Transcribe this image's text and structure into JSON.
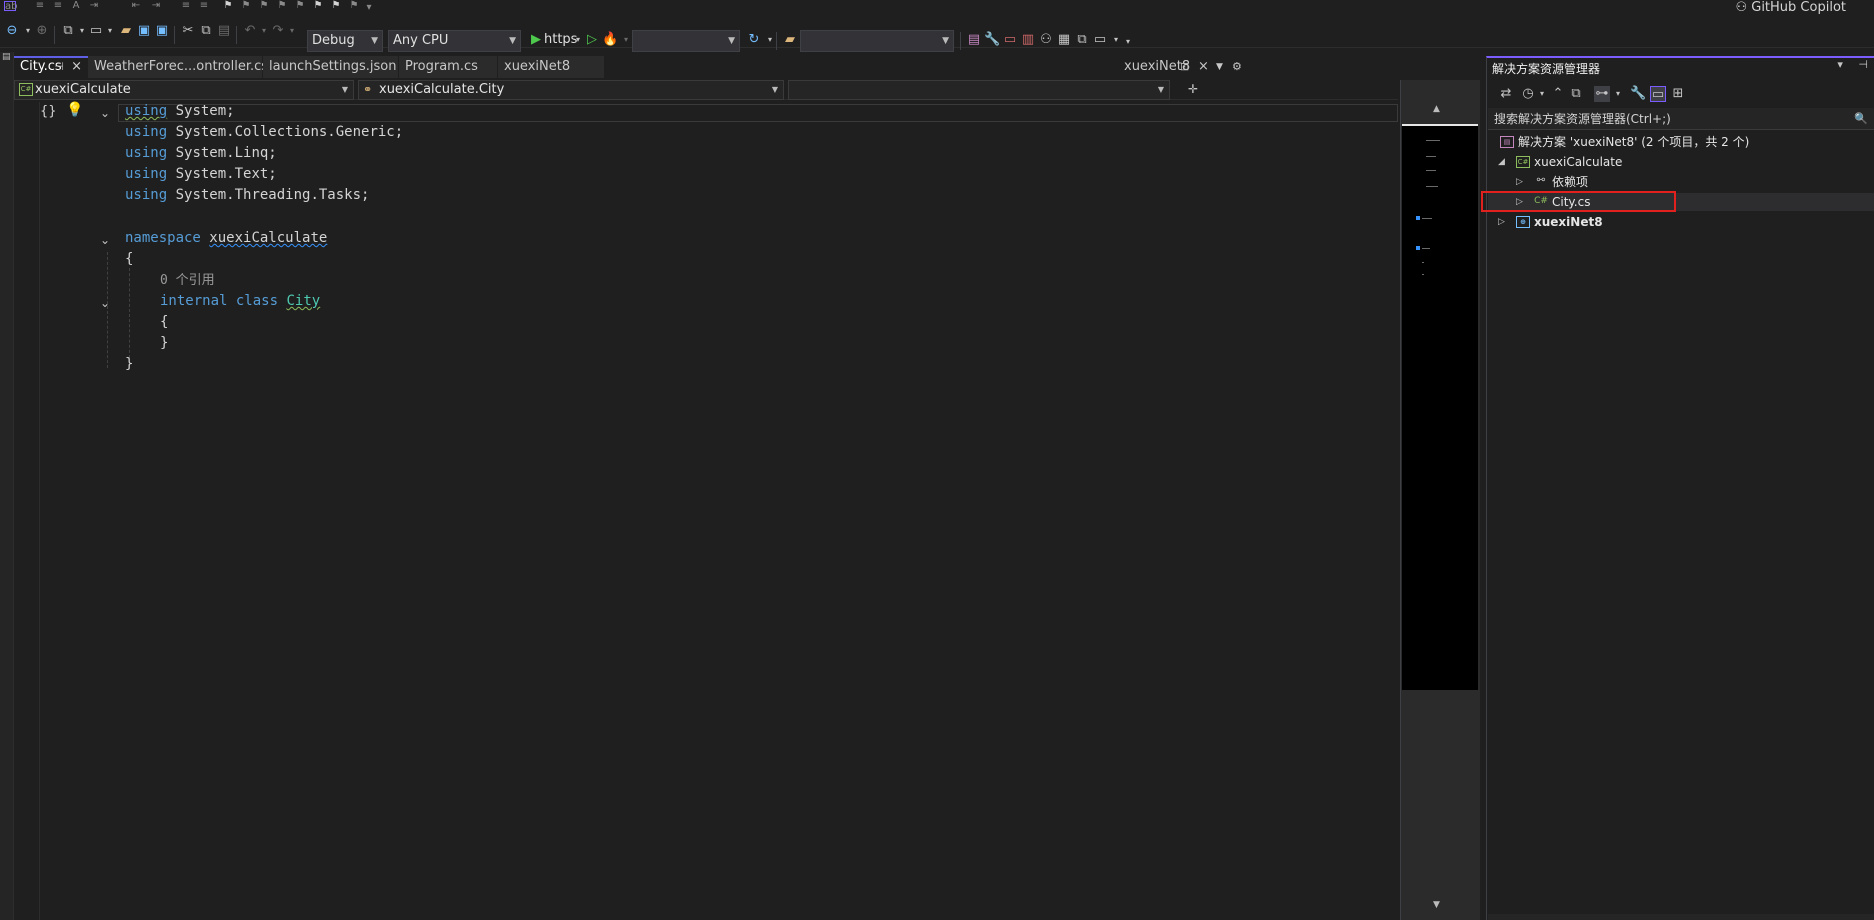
{
  "toolbar": {
    "configuration": "Debug",
    "platform": "Any CPU",
    "run_profile": "https",
    "startup_item": "",
    "search_target": "",
    "copilot_label": "GitHub Copilot"
  },
  "tabs": [
    {
      "label": "City.cs",
      "active": true
    },
    {
      "label": "WeatherForec...ontroller.cs",
      "active": false
    },
    {
      "label": "launchSettings.json",
      "active": false
    },
    {
      "label": "Program.cs",
      "active": false
    },
    {
      "label": "xuexiNet8",
      "active": false
    }
  ],
  "tab_overflow_label": "xuexiNet8",
  "navbar": {
    "project": "xuexiCalculate",
    "type": "xuexiCalculate.City",
    "member": ""
  },
  "code": {
    "line1_kw": "using",
    "line1_rest": " System;",
    "line2_kw": "using",
    "line2_rest": " System.Collections.Generic;",
    "line3_kw": "using",
    "line3_rest": " System.Linq;",
    "line4_kw": "using",
    "line4_rest": " System.Text;",
    "line5_kw": "using",
    "line5_rest": " System.Threading.Tasks;",
    "ns_kw": "namespace",
    "ns_name": "xuexiCalculate",
    "open_brace": "{",
    "refs": "0 个引用",
    "class_mod": "internal",
    "class_kw": "class",
    "class_name": "City",
    "class_open": "{",
    "class_close": "}",
    "close_brace": "}"
  },
  "solution_explorer": {
    "title": "解决方案资源管理器",
    "search_placeholder": "搜索解决方案资源管理器(Ctrl+;)",
    "solution_label": "解决方案 'xuexiNet8' (2 个项目，共 2 个)",
    "items": [
      {
        "label": "xuexiCalculate",
        "level": 1
      },
      {
        "label": "依赖项",
        "level": 2
      },
      {
        "label": "City.cs",
        "level": 2,
        "selected": true
      },
      {
        "label": "xuexiNet8",
        "level": 0
      }
    ]
  },
  "colors": {
    "keyword": "#569cd6",
    "type": "#4ec9b0",
    "accent": "#7a5cff",
    "highlight_box": "#e0211d"
  }
}
